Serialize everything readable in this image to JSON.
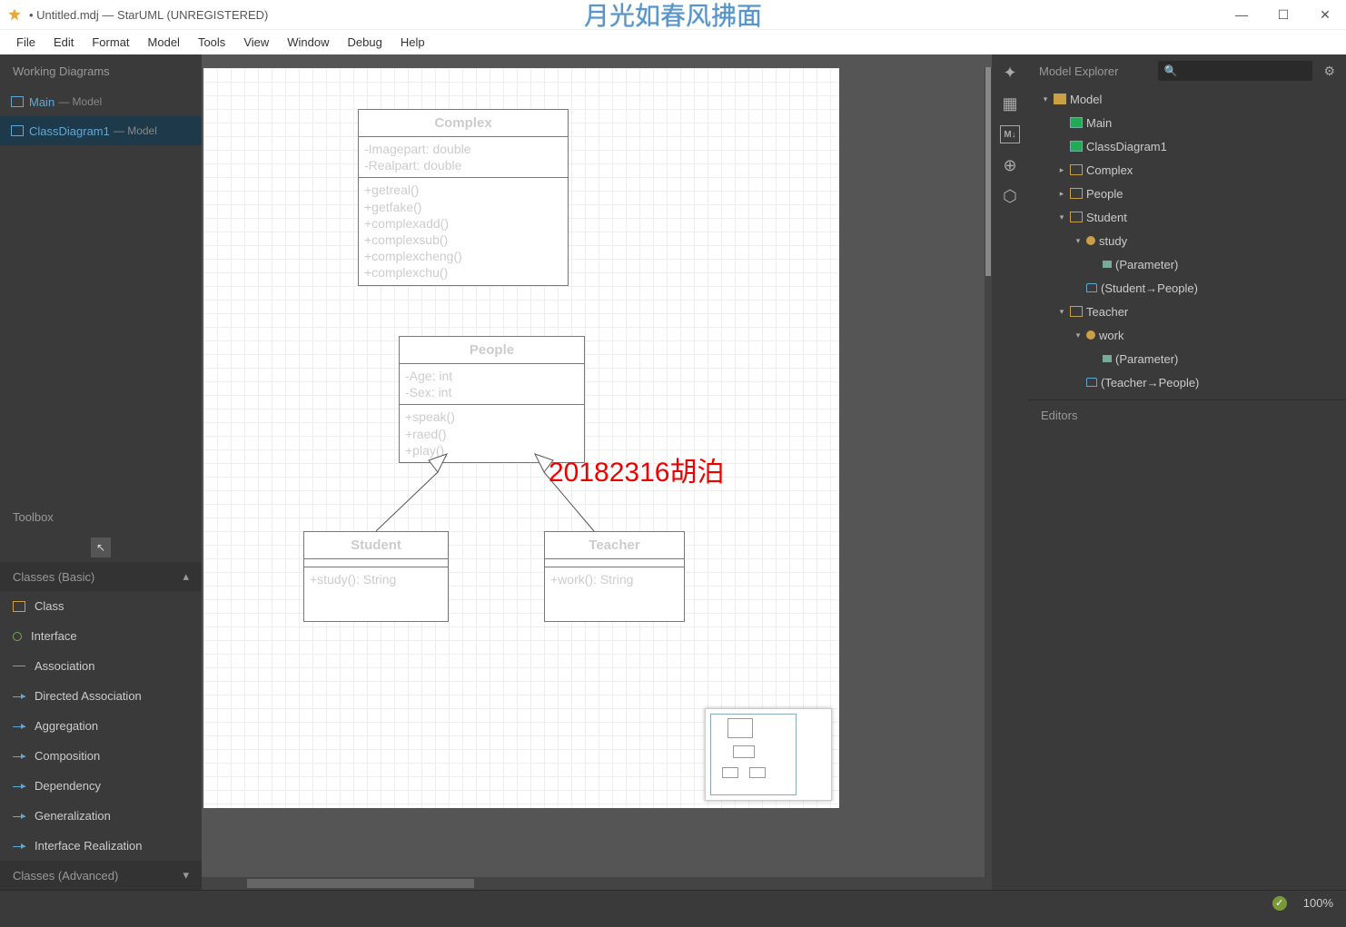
{
  "title": "• Untitled.mdj — StarUML (UNREGISTERED)",
  "watermark": "月光如春风拂面",
  "menu": [
    "File",
    "Edit",
    "Format",
    "Model",
    "Tools",
    "View",
    "Window",
    "Debug",
    "Help"
  ],
  "workingDiagrams": {
    "header": "Working Diagrams",
    "items": [
      {
        "name": "Main",
        "sub": "— Model"
      },
      {
        "name": "ClassDiagram1",
        "sub": "— Model",
        "selected": true
      }
    ]
  },
  "toolbox": {
    "header": "Toolbox",
    "sections": [
      {
        "name": "Classes (Basic)",
        "expanded": true,
        "items": [
          "Class",
          "Interface",
          "Association",
          "Directed Association",
          "Aggregation",
          "Composition",
          "Dependency",
          "Generalization",
          "Interface Realization"
        ]
      },
      {
        "name": "Classes (Advanced)",
        "expanded": false
      }
    ]
  },
  "modelExplorer": {
    "header": "Model Explorer",
    "tree": [
      {
        "ind": 0,
        "twist": "▾",
        "icon": "folder",
        "label": "Model"
      },
      {
        "ind": 1,
        "twist": "",
        "icon": "diag",
        "label": "Main"
      },
      {
        "ind": 1,
        "twist": "",
        "icon": "diag",
        "label": "ClassDiagram1"
      },
      {
        "ind": 1,
        "twist": "▸",
        "icon": "cls",
        "label": "Complex"
      },
      {
        "ind": 1,
        "twist": "▸",
        "icon": "cls",
        "label": "People"
      },
      {
        "ind": 1,
        "twist": "▾",
        "icon": "cls",
        "label": "Student"
      },
      {
        "ind": 2,
        "twist": "▾",
        "icon": "op",
        "label": "study"
      },
      {
        "ind": 3,
        "twist": "",
        "icon": "param",
        "label": "(Parameter)"
      },
      {
        "ind": 2,
        "twist": "",
        "icon": "gen",
        "label": "(Student→People)"
      },
      {
        "ind": 1,
        "twist": "▾",
        "icon": "cls",
        "label": "Teacher"
      },
      {
        "ind": 2,
        "twist": "▾",
        "icon": "op",
        "label": "work"
      },
      {
        "ind": 3,
        "twist": "",
        "icon": "param",
        "label": "(Parameter)"
      },
      {
        "ind": 2,
        "twist": "",
        "icon": "gen",
        "label": "(Teacher→People)"
      }
    ]
  },
  "editorsHeader": "Editors",
  "canvas": {
    "complex": {
      "name": "Complex",
      "attrs": [
        "-Imagepart: double",
        "-Realpart: double"
      ],
      "ops": [
        "+getreal()",
        "+getfake()",
        "+complexadd()",
        "+complexsub()",
        "+complexcheng()",
        "+complexchu()"
      ]
    },
    "people": {
      "name": "People",
      "attrs": [
        "-Age: int",
        "-Sex: int"
      ],
      "ops": [
        "+speak()",
        "+raed()",
        "+play()"
      ]
    },
    "student": {
      "name": "Student",
      "ops": [
        "+study(): String"
      ]
    },
    "teacher": {
      "name": "Teacher",
      "ops": [
        "+work(): String"
      ]
    },
    "annotation": "20182316胡泊"
  },
  "status": {
    "zoom": "100%"
  }
}
